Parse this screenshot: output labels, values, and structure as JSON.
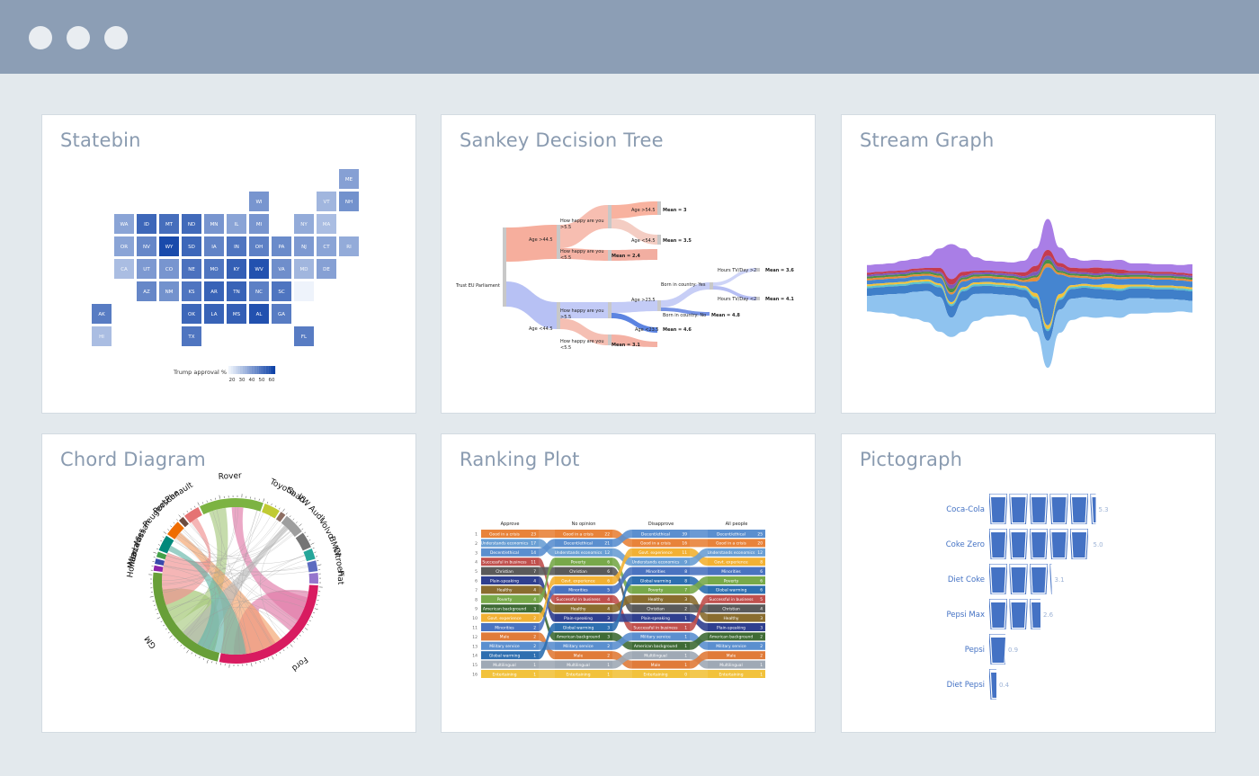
{
  "window": {
    "controls": [
      "close",
      "minimize",
      "maximize"
    ]
  },
  "cards": {
    "statebin": {
      "title": "Statebin",
      "legend_label": "Trump approval %",
      "legend_ticks": [
        "20",
        "30",
        "40",
        "50",
        "60"
      ],
      "states": [
        {
          "s": "ME",
          "c": 10,
          "r": 0,
          "v": 38
        },
        {
          "s": "WI",
          "c": 6,
          "r": 1,
          "v": 41
        },
        {
          "s": "VT",
          "c": 9,
          "r": 1,
          "v": 32
        },
        {
          "s": "NH",
          "c": 10,
          "r": 1,
          "v": 42
        },
        {
          "s": "WA",
          "c": 0,
          "r": 2,
          "v": 37
        },
        {
          "s": "ID",
          "c": 1,
          "r": 2,
          "v": 54
        },
        {
          "s": "MT",
          "c": 2,
          "r": 2,
          "v": 52
        },
        {
          "s": "ND",
          "c": 3,
          "r": 2,
          "v": 53
        },
        {
          "s": "MN",
          "c": 4,
          "r": 2,
          "v": 41
        },
        {
          "s": "IL",
          "c": 5,
          "r": 2,
          "v": 37
        },
        {
          "s": "MI",
          "c": 6,
          "r": 2,
          "v": 41
        },
        {
          "s": "NY",
          "c": 8,
          "r": 2,
          "v": 35
        },
        {
          "s": "MA",
          "c": 9,
          "r": 2,
          "v": 30
        },
        {
          "s": "OR",
          "c": 0,
          "r": 3,
          "v": 37
        },
        {
          "s": "NV",
          "c": 1,
          "r": 3,
          "v": 45
        },
        {
          "s": "WY",
          "c": 2,
          "r": 3,
          "v": 62
        },
        {
          "s": "SD",
          "c": 3,
          "r": 3,
          "v": 54
        },
        {
          "s": "IA",
          "c": 4,
          "r": 3,
          "v": 46
        },
        {
          "s": "IN",
          "c": 5,
          "r": 3,
          "v": 50
        },
        {
          "s": "OH",
          "c": 6,
          "r": 3,
          "v": 47
        },
        {
          "s": "PA",
          "c": 7,
          "r": 3,
          "v": 44
        },
        {
          "s": "NJ",
          "c": 8,
          "r": 3,
          "v": 40
        },
        {
          "s": "CT",
          "c": 9,
          "r": 3,
          "v": 37
        },
        {
          "s": "RI",
          "c": 10,
          "r": 3,
          "v": 35
        },
        {
          "s": "CA",
          "c": 0,
          "r": 4,
          "v": 30
        },
        {
          "s": "UT",
          "c": 1,
          "r": 4,
          "v": 40
        },
        {
          "s": "CO",
          "c": 2,
          "r": 4,
          "v": 41
        },
        {
          "s": "NE",
          "c": 3,
          "r": 4,
          "v": 51
        },
        {
          "s": "MO",
          "c": 4,
          "r": 4,
          "v": 50
        },
        {
          "s": "KY",
          "c": 5,
          "r": 4,
          "v": 56
        },
        {
          "s": "WV",
          "c": 6,
          "r": 4,
          "v": 60
        },
        {
          "s": "VA",
          "c": 7,
          "r": 4,
          "v": 43
        },
        {
          "s": "MD",
          "c": 8,
          "r": 4,
          "v": 32
        },
        {
          "s": "DE",
          "c": 9,
          "r": 4,
          "v": 38
        },
        {
          "s": "AZ",
          "c": 1,
          "r": 5,
          "v": 45
        },
        {
          "s": "NM",
          "c": 2,
          "r": 5,
          "v": 42
        },
        {
          "s": "KS",
          "c": 3,
          "r": 5,
          "v": 50
        },
        {
          "s": "AR",
          "c": 4,
          "r": 5,
          "v": 55
        },
        {
          "s": "TN",
          "c": 5,
          "r": 5,
          "v": 55
        },
        {
          "s": "NC",
          "c": 6,
          "r": 5,
          "v": 47
        },
        {
          "s": "SC",
          "c": 7,
          "r": 5,
          "v": 50
        },
        {
          "s": "DC",
          "c": 8,
          "r": 5,
          "v": 8
        },
        {
          "s": "AK",
          "c": -1,
          "r": 6,
          "v": 48
        },
        {
          "s": "OK",
          "c": 3,
          "r": 6,
          "v": 54
        },
        {
          "s": "LA",
          "c": 4,
          "r": 6,
          "v": 55
        },
        {
          "s": "MS",
          "c": 5,
          "r": 6,
          "v": 56
        },
        {
          "s": "AL",
          "c": 6,
          "r": 6,
          "v": 60
        },
        {
          "s": "GA",
          "c": 7,
          "r": 6,
          "v": 48
        },
        {
          "s": "HI",
          "c": -1,
          "r": 7,
          "v": 30
        },
        {
          "s": "TX",
          "c": 3,
          "r": 7,
          "v": 50
        },
        {
          "s": "FL",
          "c": 8,
          "r": 7,
          "v": 48
        }
      ]
    },
    "sankey": {
      "title": "Sankey Decision Tree",
      "labels": {
        "root": "Trust EU Parliament",
        "age_gt": "Age >44.5",
        "age_lt": "Age <44.5",
        "happy1": "How happy are you\n>5.5",
        "happy2": "How happy are you\n<5.5",
        "age_gt545": "Age >54.5",
        "age_lt545": "Age <54.5",
        "mean3": "Mean = 3",
        "mean35": "Mean = 3.5",
        "mean24": "Mean = 2.4",
        "happy3": "How happy are you\n>5.5",
        "happy4": "How happy are you\n<5.5",
        "age_gt235": "Age >23.5",
        "age_lt235": "Age <23.5",
        "mean46": "Mean = 4.6",
        "mean31": "Mean = 3.1",
        "born_yes": "Born in country: Yes",
        "born_no": "Born in country: No",
        "mean48": "Mean = 4.8",
        "tv_gt": "Hours TV/Day >2",
        "tv_lt": "Hours TV/Day <2",
        "mean36": "Mean = 3.6",
        "mean41": "Mean = 4.1"
      }
    },
    "stream": {
      "title": "Stream Graph",
      "colors": [
        "#a97ee6",
        "#c53b4e",
        "#7b5bb8",
        "#4a8f4a",
        "#e58f3a",
        "#4585d0",
        "#f2c23c",
        "#5ec3c9",
        "#3f7fc9",
        "#8fc3ef"
      ],
      "layers": [
        [
          4,
          4,
          4,
          5,
          5,
          6,
          10,
          18,
          12,
          7,
          5,
          5,
          5,
          6,
          9,
          16,
          8,
          5,
          4,
          4,
          4,
          5,
          4,
          4,
          4,
          4,
          4,
          5
        ],
        [
          1,
          1,
          1,
          1,
          1,
          1,
          2,
          3,
          2,
          1,
          1,
          1,
          1,
          2,
          3,
          3,
          2,
          2,
          2,
          3,
          2,
          2,
          1,
          1,
          1,
          1,
          1,
          1
        ],
        [
          1,
          1,
          1,
          1,
          1,
          1,
          1,
          2,
          1,
          1,
          1,
          1,
          1,
          1,
          2,
          2,
          2,
          1,
          1,
          1,
          1,
          1,
          1,
          1,
          1,
          1,
          1,
          1
        ],
        [
          1,
          1,
          1,
          1,
          1,
          1,
          1,
          2,
          1,
          1,
          1,
          1,
          1,
          1,
          1,
          2,
          1,
          1,
          1,
          1,
          1,
          1,
          1,
          1,
          1,
          1,
          1,
          1
        ],
        [
          1,
          1,
          1,
          1,
          1,
          1,
          1,
          1,
          1,
          1,
          1,
          1,
          1,
          1,
          2,
          2,
          1,
          1,
          1,
          1,
          1,
          1,
          1,
          1,
          1,
          1,
          1,
          1
        ],
        [
          2,
          2,
          2,
          2,
          2,
          2,
          3,
          4,
          3,
          2,
          2,
          2,
          2,
          2,
          6,
          30,
          10,
          4,
          3,
          3,
          3,
          3,
          3,
          3,
          3,
          3,
          3,
          3
        ],
        [
          1,
          1,
          1,
          1,
          1,
          1,
          1,
          1,
          1,
          1,
          1,
          1,
          1,
          1,
          2,
          2,
          2,
          1,
          1,
          1,
          2,
          2,
          1,
          1,
          1,
          1,
          1,
          1
        ],
        [
          1,
          1,
          1,
          1,
          1,
          1,
          1,
          1,
          1,
          1,
          1,
          1,
          1,
          1,
          1,
          1,
          1,
          1,
          1,
          1,
          1,
          1,
          1,
          1,
          1,
          1,
          1,
          1
        ],
        [
          4,
          4,
          4,
          4,
          4,
          4,
          5,
          6,
          5,
          4,
          4,
          4,
          4,
          4,
          5,
          5,
          5,
          5,
          5,
          5,
          5,
          5,
          5,
          5,
          5,
          5,
          5,
          5
        ],
        [
          8,
          9,
          10,
          12,
          14,
          16,
          18,
          10,
          16,
          14,
          12,
          11,
          10,
          10,
          12,
          14,
          12,
          11,
          10,
          10,
          9,
          9,
          8,
          8,
          7,
          7,
          6,
          6
        ]
      ]
    },
    "chord": {
      "title": "Chord Diagram",
      "groups": [
        {
          "name": "Rover",
          "value": 12,
          "color": "#7cb342"
        },
        {
          "name": "Toyota",
          "value": 3,
          "color": "#c0ca33"
        },
        {
          "name": "Saab",
          "value": 1,
          "color": "#8d6e63"
        },
        {
          "name": "VW Audi",
          "value": 4,
          "color": "#9e9e9e"
        },
        {
          "name": "Volvo",
          "value": 3,
          "color": "#757575"
        },
        {
          "name": "BMW",
          "value": 2,
          "color": "#26a69a"
        },
        {
          "name": "Citroen",
          "value": 2,
          "color": "#5c6bc0"
        },
        {
          "name": "Fiat",
          "value": 2,
          "color": "#9575cd"
        },
        {
          "name": "Ford",
          "value": 26,
          "color": "#d81b60"
        },
        {
          "name": "GM",
          "value": 22,
          "color": "#689f38"
        },
        {
          "name": "Honda",
          "value": 1,
          "color": "#8e24aa"
        },
        {
          "name": "Mazda",
          "value": 1,
          "color": "#3949ab"
        },
        {
          "name": "Mercedes",
          "value": 1,
          "color": "#43a047"
        },
        {
          "name": "Nissan",
          "value": 3,
          "color": "#00897b"
        },
        {
          "name": "Peugeot",
          "value": 3,
          "color": "#ef6c00"
        },
        {
          "name": "Porsche",
          "value": 1,
          "color": "#6d4c41"
        },
        {
          "name": "Renault",
          "value": 3,
          "color": "#e57373"
        }
      ],
      "tick_labels": [
        "0",
        "5",
        "10",
        "15",
        "20",
        "25",
        "30",
        "35",
        "40",
        "45",
        "50",
        "55",
        "60",
        "65",
        "70",
        "75",
        "80",
        "85",
        "90"
      ]
    },
    "ranking": {
      "title": "Ranking Plot",
      "columns": [
        "Approve",
        "No opinion",
        "Disapprove",
        "All people"
      ],
      "categories": [
        {
          "name": "Good in a crisis",
          "color": "#e8833a"
        },
        {
          "name": "Understands economics",
          "color": "#6a9fd4"
        },
        {
          "name": "Decent/ethical",
          "color": "#5b8fcf"
        },
        {
          "name": "Successful in business",
          "color": "#c0504d"
        },
        {
          "name": "Christian",
          "color": "#5a5a5a"
        },
        {
          "name": "Plain-speaking",
          "color": "#2f3f8f"
        },
        {
          "name": "Healthy",
          "color": "#8a6d2f"
        },
        {
          "name": "Poverty",
          "color": "#78a94a"
        },
        {
          "name": "American background",
          "color": "#3f6b35"
        },
        {
          "name": "Govt. experience",
          "color": "#f2b134"
        },
        {
          "name": "Minorities",
          "color": "#4a73c0"
        },
        {
          "name": "Male",
          "color": "#e07b39"
        },
        {
          "name": "Military service",
          "color": "#5b8fcf"
        },
        {
          "name": "Global warming",
          "color": "#2e6fb0"
        },
        {
          "name": "Multilingual",
          "color": "#9fa9b5"
        },
        {
          "name": "Entertaining",
          "color": "#f2c23c"
        }
      ],
      "approve": [
        [
          "Good in a crisis",
          23
        ],
        [
          "Understands economics",
          17
        ],
        [
          "Decent/ethical",
          14
        ],
        [
          "Successful in business",
          11
        ],
        [
          "Christian",
          7
        ],
        [
          "Plain-speaking",
          4
        ],
        [
          "Healthy",
          4
        ],
        [
          "Poverty",
          4
        ],
        [
          "American background",
          3
        ],
        [
          "Govt. experience",
          2
        ],
        [
          "Minorities",
          2
        ],
        [
          "Male",
          2
        ],
        [
          "Military service",
          2
        ],
        [
          "Global warming",
          1
        ],
        [
          "Multilingual",
          1
        ],
        [
          "Entertaining",
          1
        ]
      ],
      "noopinion": [
        [
          "Good in a crisis",
          22
        ],
        [
          "Decent/ethical",
          21
        ],
        [
          "Understands economics",
          12
        ],
        [
          "Poverty",
          6
        ],
        [
          "Christian",
          6
        ],
        [
          "Govt. experience",
          6
        ],
        [
          "Minorities",
          5
        ],
        [
          "Successful in business",
          4
        ],
        [
          "Healthy",
          4
        ],
        [
          "Plain-speaking",
          3
        ],
        [
          "Global warming",
          3
        ],
        [
          "American background",
          3
        ],
        [
          "Military service",
          2
        ],
        [
          "Male",
          2
        ],
        [
          "Multilingual",
          1
        ],
        [
          "Entertaining",
          1
        ]
      ],
      "disapprove": [
        [
          "Decent/ethical",
          39
        ],
        [
          "Good in a crisis",
          16
        ],
        [
          "Govt. experience",
          11
        ],
        [
          "Understands economics",
          9
        ],
        [
          "Minorities",
          8
        ],
        [
          "Global warming",
          8
        ],
        [
          "Poverty",
          7
        ],
        [
          "Healthy",
          3
        ],
        [
          "Christian",
          2
        ],
        [
          "Plain-speaking",
          1
        ],
        [
          "Successful in business",
          1
        ],
        [
          "Military service",
          1
        ],
        [
          "American background",
          1
        ],
        [
          "Multilingual",
          1
        ],
        [
          "Male",
          1
        ],
        [
          "Entertaining",
          0
        ]
      ],
      "allpeople": [
        [
          "Decent/ethical",
          25
        ],
        [
          "Good in a crisis",
          20
        ],
        [
          "Understands economics",
          12
        ],
        [
          "Govt. experience",
          8
        ],
        [
          "Minorities",
          6
        ],
        [
          "Poverty",
          6
        ],
        [
          "Global warming",
          6
        ],
        [
          "Successful in business",
          5
        ],
        [
          "Christian",
          4
        ],
        [
          "Healthy",
          3
        ],
        [
          "Plain-speaking",
          3
        ],
        [
          "American background",
          2
        ],
        [
          "Military service",
          2
        ],
        [
          "Male",
          2
        ],
        [
          "Multilingual",
          1
        ],
        [
          "Entertaining",
          1
        ]
      ]
    },
    "pictograph": {
      "title": "Pictograph",
      "icon_color": "#4472c4",
      "rows": [
        {
          "label": "Coca-Cola",
          "value": 5.3
        },
        {
          "label": "Coke Zero",
          "value": 5.0
        },
        {
          "label": "Diet Coke",
          "value": 3.1
        },
        {
          "label": "Pepsi Max",
          "value": 2.6
        },
        {
          "label": "Pepsi",
          "value": 0.9
        },
        {
          "label": "Diet Pepsi",
          "value": 0.4
        }
      ],
      "value_labels": [
        "5.3",
        "5.0",
        "3.1",
        "2.6",
        "0.9",
        "0.4"
      ]
    }
  }
}
